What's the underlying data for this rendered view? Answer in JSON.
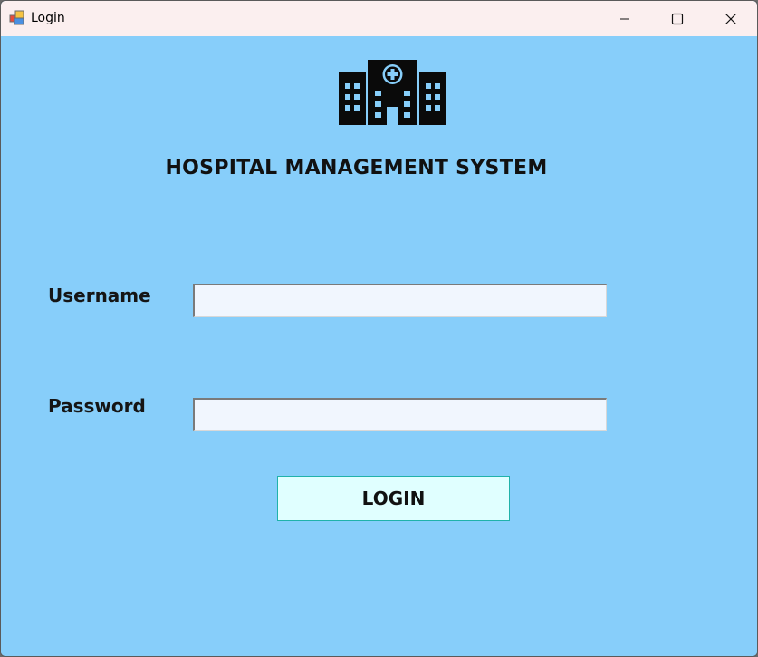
{
  "window": {
    "title": "Login"
  },
  "titlebar": {
    "controls": [
      "minimize",
      "maximize",
      "close"
    ]
  },
  "header": {
    "icon": "hospital-building-icon",
    "title": "HOSPITAL MANAGEMENT SYSTEM"
  },
  "form": {
    "username_label": "Username",
    "username_value": "",
    "password_label": "Password",
    "password_value": "",
    "login_label": "LOGIN"
  },
  "colors": {
    "background": "#87cefa",
    "titlebar": "#fbefef",
    "textbox": "#f1f6fe",
    "button": "#e0ffff",
    "button_border": "#20b2aa"
  }
}
